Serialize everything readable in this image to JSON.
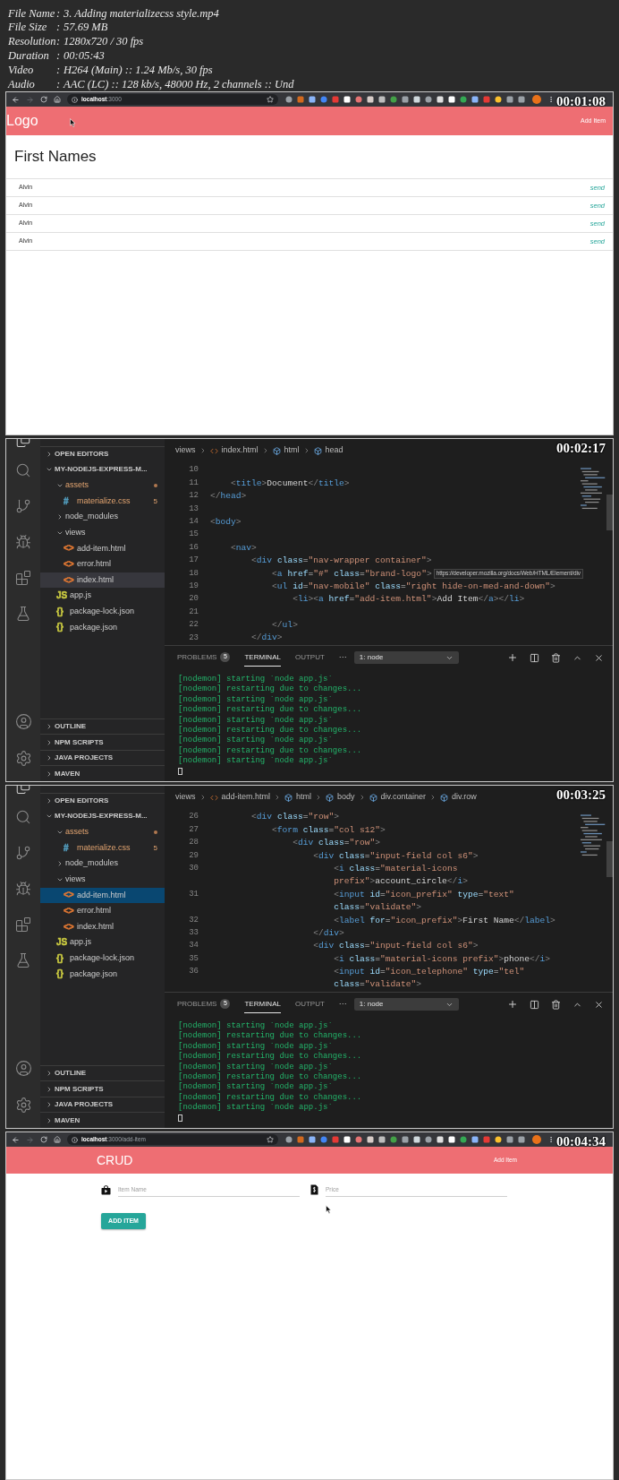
{
  "separator": ":",
  "file_info": [
    {
      "label": "File Name",
      "value": "3. Adding materializecss style.mp4"
    },
    {
      "label": "File Size",
      "value": "57.69 MB"
    },
    {
      "label": "Resolution",
      "value": "1280x720 / 30 fps"
    },
    {
      "label": "Duration",
      "value": "00:05:43"
    },
    {
      "label": "Video",
      "value": "H264 (Main) :: 1.24 Mb/s, 30 fps"
    },
    {
      "label": "Audio",
      "value": "AAC (LC) :: 128 kb/s, 48000 Hz, 2 channels :: Und"
    }
  ],
  "frames": [
    {
      "kind": "browser_list",
      "timestamp": "00:01:08",
      "url": "**localhost**:3000",
      "brand": "Logo",
      "nav_link": "Add Item",
      "heading": "First Names",
      "rows": [
        {
          "name": "Alvin",
          "action": "send"
        },
        {
          "name": "Alvin",
          "action": "send"
        },
        {
          "name": "Alvin",
          "action": "send"
        },
        {
          "name": "Alvin",
          "action": "send"
        }
      ]
    },
    {
      "kind": "editor",
      "timestamp": "00:02:17",
      "explorer": {
        "focused": false,
        "open_editors": {
          "label": "OPEN EDITORS",
          "expanded": false
        },
        "project": {
          "label": "MY-NODEJS-EXPRESS-M...",
          "expanded": true,
          "items": [
            {
              "name": "assets",
              "expanded": true,
              "warning": true,
              "selected": false,
              "children": [
                {
                  "name": "materialize.css",
                  "icon": "#",
                  "color": "#519aba",
                  "warning": true,
                  "badge": "5",
                  "selected": false
                }
              ]
            },
            {
              "name": "node_modules",
              "expanded": false,
              "warning": false,
              "selected": false
            },
            {
              "name": "views",
              "expanded": true,
              "warning": false,
              "selected": false,
              "children": [
                {
                  "name": "add-item.html",
                  "icon": "<>",
                  "color": "#e37933",
                  "warning": false,
                  "selected": false
                },
                {
                  "name": "error.html",
                  "icon": "<>",
                  "color": "#e37933",
                  "warning": false,
                  "selected": false
                },
                {
                  "name": "index.html",
                  "icon": "<>",
                  "color": "#e37933",
                  "warning": false,
                  "selected": true
                }
              ]
            },
            {
              "name": "app.js",
              "icon": "JS",
              "color": "#cbcb41",
              "warning": false,
              "selected": false
            },
            {
              "name": "package-lock.json",
              "icon": "{}",
              "color": "#cbcb41",
              "warning": false,
              "selected": false
            },
            {
              "name": "package.json",
              "icon": "{}",
              "color": "#cbcb41",
              "warning": false,
              "selected": false
            }
          ]
        },
        "bottom_sections": [
          {
            "label": "OUTLINE",
            "expanded": false
          },
          {
            "label": "NPM SCRIPTS",
            "expanded": false
          },
          {
            "label": "JAVA PROJECTS",
            "expanded": false
          },
          {
            "label": "MAVEN",
            "expanded": false
          }
        ]
      },
      "breadcrumb": [
        {
          "label": "views"
        },
        {
          "label": "index.html"
        },
        {
          "label": "html"
        },
        {
          "label": "head"
        }
      ],
      "code": [
        {
          "number": "10"
        },
        {
          "number": "11",
          "text": "    <title>Document</title>"
        },
        {
          "number": "12",
          "text": "</head>"
        },
        {
          "number": "13"
        },
        {
          "number": "14",
          "text": "<body>"
        },
        {
          "number": "15"
        },
        {
          "number": "16",
          "text": "    <nav>"
        },
        {
          "number": "17",
          "text": "        <div class=\"nav-wrapper container\">"
        },
        {
          "number": "18",
          "text": "            <a href=\"#\" class=\"brand-logo\">",
          "tooltip": "https://developer.mozilla.org/docs/Web/HTML/Element/div"
        },
        {
          "number": "19",
          "text": "            <ul id=\"nav-mobile\" class=\"right hide-on-med-and-down\">"
        },
        {
          "number": "20",
          "text": "                <li><a href=\"add-item.html\">Add Item</a></li>"
        },
        {
          "number": "21"
        },
        {
          "number": "22",
          "text": "            </ul>"
        },
        {
          "number": "23",
          "text": "        </div>"
        }
      ],
      "panel": {
        "tabs": [
          {
            "label": "PROBLEMS",
            "badge": "5",
            "selected": false
          },
          {
            "label": "TERMINAL",
            "selected": true
          },
          {
            "label": "OUTPUT",
            "selected": false
          }
        ],
        "more": "···",
        "terminal_select": "1: node",
        "lines": [
          "[nodemon] starting `node app.js`",
          "[nodemon] restarting due to changes...",
          "[nodemon] starting `node app.js`",
          "[nodemon] restarting due to changes...",
          "[nodemon] starting `node app.js`",
          "[nodemon] restarting due to changes...",
          "[nodemon] starting `node app.js`",
          "[nodemon] restarting due to changes...",
          "[nodemon] starting `node app.js`"
        ]
      }
    },
    {
      "kind": "editor",
      "timestamp": "00:03:25",
      "explorer": {
        "focused": true,
        "open_editors": {
          "label": "OPEN EDITORS",
          "expanded": false
        },
        "project": {
          "label": "MY-NODEJS-EXPRESS-M...",
          "expanded": true,
          "items": [
            {
              "name": "assets",
              "expanded": true,
              "warning": true,
              "selected": false,
              "children": [
                {
                  "name": "materialize.css",
                  "icon": "#",
                  "color": "#519aba",
                  "warning": true,
                  "badge": "5",
                  "selected": false
                }
              ]
            },
            {
              "name": "node_modules",
              "expanded": false,
              "warning": false,
              "selected": false
            },
            {
              "name": "views",
              "expanded": true,
              "warning": false,
              "selected": false,
              "children": [
                {
                  "name": "add-item.html",
                  "icon": "<>",
                  "color": "#e37933",
                  "warning": false,
                  "selected": true
                },
                {
                  "name": "error.html",
                  "icon": "<>",
                  "color": "#e37933",
                  "warning": false,
                  "selected": false
                },
                {
                  "name": "index.html",
                  "icon": "<>",
                  "color": "#e37933",
                  "warning": false,
                  "selected": false
                }
              ]
            },
            {
              "name": "app.js",
              "icon": "JS",
              "color": "#cbcb41",
              "warning": false,
              "selected": false
            },
            {
              "name": "package-lock.json",
              "icon": "{}",
              "color": "#cbcb41",
              "warning": false,
              "selected": false
            },
            {
              "name": "package.json",
              "icon": "{}",
              "color": "#cbcb41",
              "warning": false,
              "selected": false
            }
          ]
        },
        "bottom_sections": [
          {
            "label": "OUTLINE",
            "expanded": false
          },
          {
            "label": "NPM SCRIPTS",
            "expanded": false
          },
          {
            "label": "JAVA PROJECTS",
            "expanded": false
          },
          {
            "label": "MAVEN",
            "expanded": false
          }
        ]
      },
      "breadcrumb": [
        {
          "label": "views"
        },
        {
          "label": "add-item.html"
        },
        {
          "label": "html"
        },
        {
          "label": "body"
        },
        {
          "label": "div.container"
        },
        {
          "label": "div.row"
        }
      ],
      "code": [
        {
          "number": "26",
          "text": "        <div class=\"row\">"
        },
        {
          "number": "27",
          "text": "            <form class=\"col s12\">"
        },
        {
          "number": "28",
          "text": "                <div class=\"row\">"
        },
        {
          "number": "29",
          "text": "                    <div class=\"input-field col s6\">"
        },
        {
          "number": "30",
          "text": "                        <i class=\"material-icons"
        },
        {
          "text": "                        prefix\">account_circle</i>"
        },
        {
          "number": "31",
          "text": "                        <input id=\"icon_prefix\" type=\"text\""
        },
        {
          "text": "                        class=\"validate\">"
        },
        {
          "number": "32",
          "text": "                        <label for=\"icon_prefix\">First Name</label>"
        },
        {
          "number": "33",
          "text": "                    </div>"
        },
        {
          "number": "34",
          "text": "                    <div class=\"input-field col s6\">"
        },
        {
          "number": "35",
          "text": "                        <i class=\"material-icons prefix\">phone</i>"
        },
        {
          "number": "36",
          "text": "                        <input id=\"icon_telephone\" type=\"tel\""
        },
        {
          "text": "                        class=\"validate\">"
        }
      ],
      "panel": {
        "tabs": [
          {
            "label": "PROBLEMS",
            "badge": "5",
            "selected": false
          },
          {
            "label": "TERMINAL",
            "selected": true
          },
          {
            "label": "OUTPUT",
            "selected": false
          }
        ],
        "more": "···",
        "terminal_select": "1: node",
        "lines": [
          "[nodemon] starting `node app.js`",
          "[nodemon] restarting due to changes...",
          "[nodemon] starting `node app.js`",
          "[nodemon] restarting due to changes...",
          "[nodemon] starting `node app.js`",
          "[nodemon] restarting due to changes...",
          "[nodemon] starting `node app.js`",
          "[nodemon] restarting due to changes...",
          "[nodemon] starting `node app.js`"
        ]
      }
    },
    {
      "kind": "browser_form",
      "timestamp": "00:04:34",
      "url": "**localhost**:3000/add-item",
      "brand": "CRUD",
      "nav_link": "Add Item",
      "fields": [
        {
          "placeholder": "Item Name"
        },
        {
          "placeholder": "Price"
        }
      ],
      "button": "ADD ITEM"
    }
  ]
}
